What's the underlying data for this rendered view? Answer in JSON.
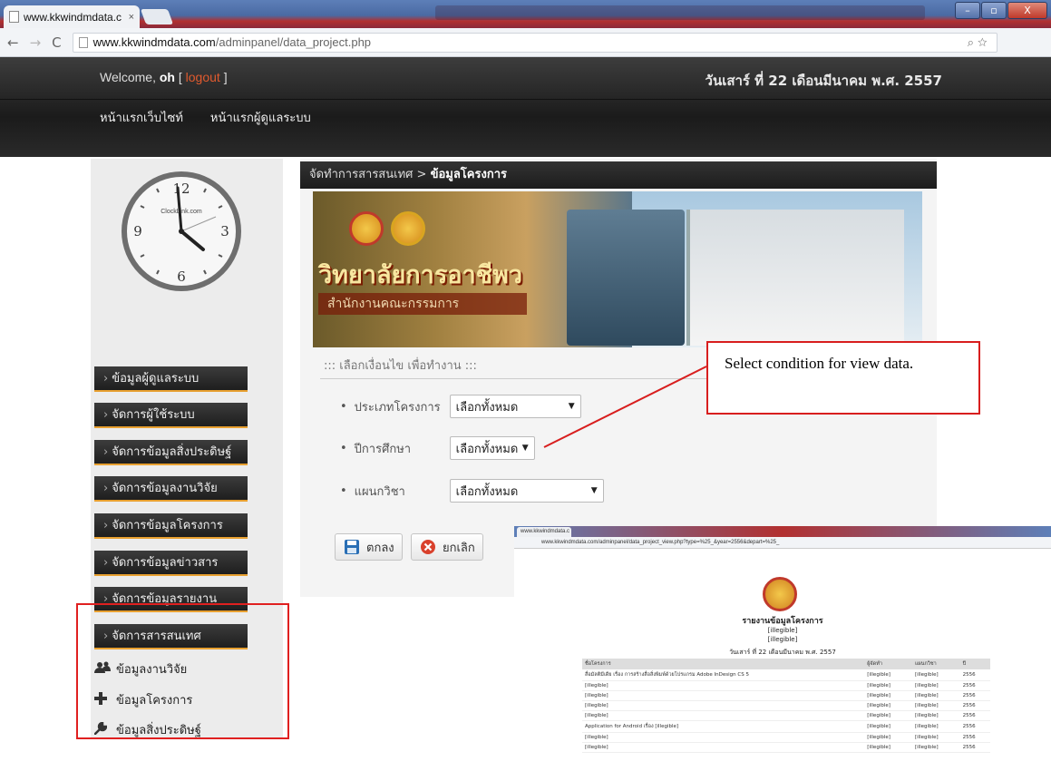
{
  "browser": {
    "tab_title": "www.kkwindmdata.c",
    "tab_close": "×",
    "url_host": "www.kkwindmdata.com",
    "url_path": "/adminpanel/data_project.php",
    "window_buttons": [
      "–",
      "▫",
      "X"
    ]
  },
  "header": {
    "welcome_prefix": "Welcome,",
    "username": "oh",
    "logout_open": "[",
    "logout_label": "logout",
    "logout_close": "]",
    "thai_date": "วันเสาร์ ที่ 22 เดือนมีนาคม พ.ศ. 2557",
    "nav": [
      "หน้าแรกเว็บไซท์",
      "หน้าแรกผู้ดูแลระบบ"
    ]
  },
  "clock": {
    "brand": "ClockLink.com",
    "numerals": [
      "12",
      "3",
      "6",
      "9"
    ]
  },
  "sidebar": {
    "menu": [
      "ข้อมูลผู้ดูแลระบบ",
      "จัดการผู้ใช้ระบบ",
      "จัดการข้อมูลสิ่งประดิษฐ์",
      "จัดการข้อมูลงานวิจัย",
      "จัดการข้อมูลโครงการ",
      "จัดการข้อมูลข่าวสาร",
      "จัดการข้อมูลรายงาน",
      "จัดการสารสนเทศ"
    ],
    "submenu": [
      {
        "label": "ข้อมูลงานวิจัย",
        "icon": "users-icon"
      },
      {
        "label": "ข้อมูลโครงการ",
        "icon": "plus-icon"
      },
      {
        "label": "ข้อมูลสิ่งประดิษฐ์",
        "icon": "wrench-icon"
      }
    ]
  },
  "main": {
    "breadcrumb_parent": "จัดทำการสารสนเทศ",
    "breadcrumb_sep": ">",
    "breadcrumb_current": "ข้อมูลโครงการ",
    "banner_title": "วิทยาลัยการอาชีพว",
    "banner_sub": "สำนักงานคณะกรรมการ",
    "form_heading": "::: เลือกเงื่อนไข เพื่อทำงาน :::",
    "filters": [
      {
        "label": "ประเภทโครงการ",
        "value": "เลือกทั้งหมด"
      },
      {
        "label": "ปีการศึกษา",
        "value": "เลือกทั้งหมด"
      },
      {
        "label": "แผนกวิชา",
        "value": "เลือกทั้งหมด"
      }
    ],
    "ok_label": "ตกลง",
    "cancel_label": "ยกเลิก"
  },
  "annotation": {
    "text": "Select condition for view data."
  },
  "inset": {
    "tab_title": "www.kkwindmdata.c",
    "url": "www.kkwindmdata.com/adminpanel/data_project_view.php?type=%25_&year=2556&depart=%25_",
    "title": "รายงานข้อมูลโครงการ",
    "line1": "[illegible]",
    "line2": "[illegible]",
    "date": "วันเสาร์ ที่ 22 เดือนมีนาคม พ.ศ. 2557",
    "columns": [
      "ชื่อโครงการ",
      "ผู้จัดทำ",
      "แผนกวิชา",
      "ปี"
    ],
    "rows": [
      [
        "สื่อมัลติมีเดีย เรื่อง การสร้างสื่อสิ่งพิมพ์ด้วยโปรแกรม Adobe InDesign CS 5",
        "[illegible]",
        "[illegible]",
        "2556"
      ],
      [
        "[illegible]",
        "[illegible]",
        "[illegible]",
        "2556"
      ],
      [
        "[illegible]",
        "[illegible]",
        "[illegible]",
        "2556"
      ],
      [
        "[illegible]",
        "[illegible]",
        "[illegible]",
        "2556"
      ],
      [
        "[illegible]",
        "[illegible]",
        "[illegible]",
        "2556"
      ],
      [
        "Application for Android เรื่อง [illegible]",
        "[illegible]",
        "[illegible]",
        "2556"
      ],
      [
        "[illegible]",
        "[illegible]",
        "[illegible]",
        "2556"
      ],
      [
        "[illegible]",
        "[illegible]",
        "[illegible]",
        "2556"
      ]
    ]
  }
}
